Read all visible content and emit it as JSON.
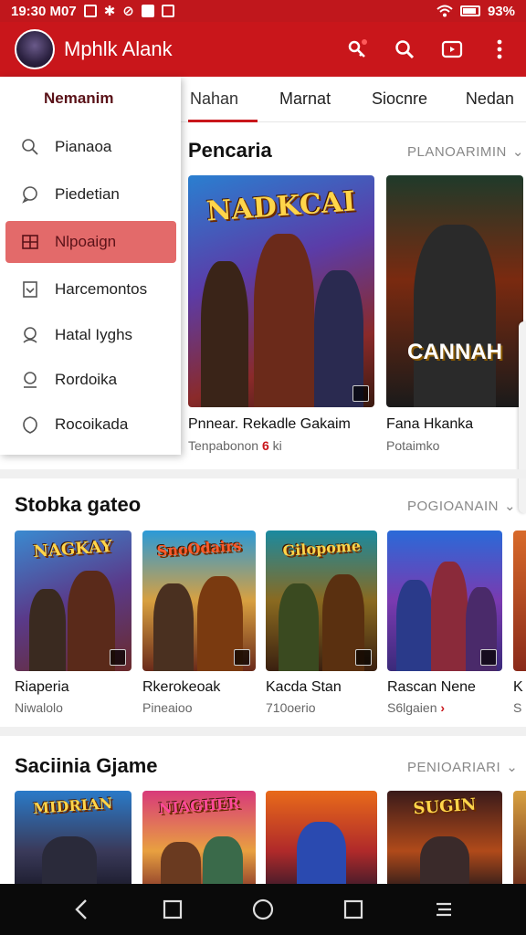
{
  "status": {
    "time": "19:30 M07",
    "battery": "93%"
  },
  "app": {
    "title": "Mphlk Alank"
  },
  "tabs": [
    {
      "label": "Nahan"
    },
    {
      "label": "Marnat"
    },
    {
      "label": "Siocnre"
    },
    {
      "label": "Nedan"
    }
  ],
  "drawer": {
    "header": "Nemanim",
    "items": [
      {
        "label": "Pianaoa",
        "icon": "search-icon"
      },
      {
        "label": "Piedetian",
        "icon": "chat-icon"
      },
      {
        "label": "Nlpoaign",
        "icon": "grid-icon",
        "active": true
      },
      {
        "label": "Harcemontos",
        "icon": "document-icon"
      },
      {
        "label": "Hatal Iyghs",
        "icon": "user-icon"
      },
      {
        "label": "Rordoika",
        "icon": "user-circle-icon"
      },
      {
        "label": "Rocoikada",
        "icon": "shield-icon"
      }
    ]
  },
  "sections": [
    {
      "title": "Pencaria",
      "more": "PLANOARIMIN",
      "cards": [
        {
          "name": "Pnnear. Rekadle Gakaim",
          "sub": "Tenpabonon",
          "sub_accent": "6",
          "sub_tail": "ki",
          "art": "NADKCAI"
        },
        {
          "name": "Fana Hkanka",
          "sub": "Potaimko",
          "art": "CANNAH"
        }
      ]
    },
    {
      "title": "Stobka gateo",
      "more": "POGIOANAIN",
      "cards": [
        {
          "name": "Riaperia",
          "sub": "Niwalolo",
          "art": "NAGKAY"
        },
        {
          "name": "Rkerokeoak",
          "sub": "Pineaioo",
          "art": "SnoOdairs"
        },
        {
          "name": "Kacda Stan",
          "sub": "710oerio",
          "art": "Gilopome"
        },
        {
          "name": "Rascan Nene",
          "sub": "S6lgaien",
          "sub_arrow": "›",
          "art": ""
        },
        {
          "name": "K",
          "sub": "S",
          "art": ""
        }
      ]
    },
    {
      "title": "Saciinia Gjame",
      "more": "PENIOARIARI",
      "cards": [
        {
          "art": "MIDRIAN"
        },
        {
          "art": "NIAGHER"
        },
        {
          "art": ""
        },
        {
          "art": "SUGIN"
        },
        {
          "art": ""
        }
      ]
    }
  ],
  "colors": {
    "primary": "#c9161b",
    "drawer_active": "#e36a6a"
  }
}
